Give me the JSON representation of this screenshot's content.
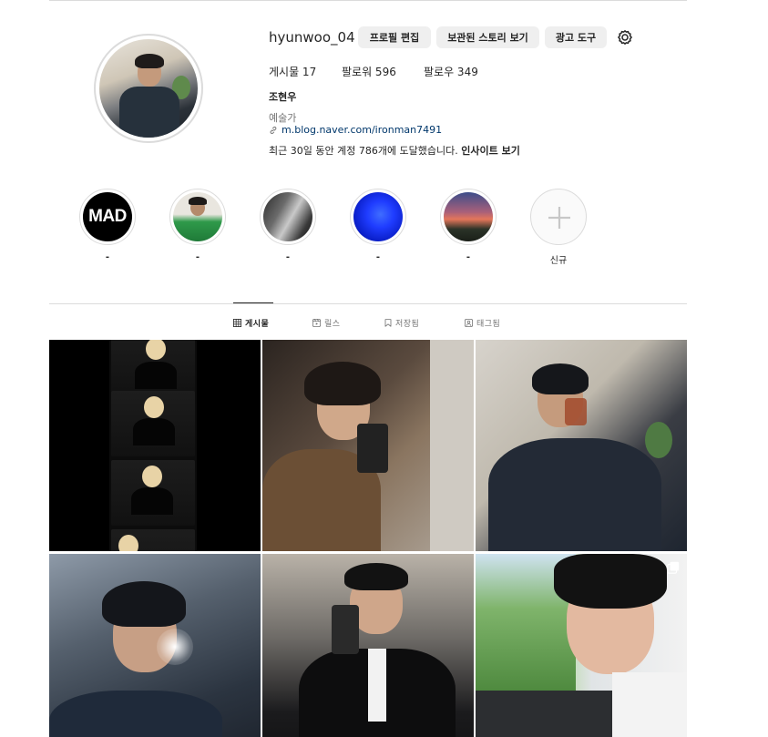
{
  "profile": {
    "username": "hyunwoo_04",
    "buttons": {
      "edit": "프로필 편집",
      "archive": "보관된 스토리 보기",
      "ads": "광고 도구"
    },
    "settings_icon": "gear-icon",
    "stats": {
      "posts": "게시물 17",
      "followers": "팔로워 596",
      "following": "팔로우 349"
    },
    "full_name": "조현우",
    "category": "예술가",
    "link": "m.blog.naver.com/ironman7491",
    "insight_text": "최근 30일 동안 계정 786개에 도달했습니다.",
    "insight_link": "인사이트 보기"
  },
  "highlights": [
    {
      "label": "-",
      "text": "MAD"
    },
    {
      "label": "-"
    },
    {
      "label": "-"
    },
    {
      "label": "-"
    },
    {
      "label": "-"
    },
    {
      "label": "신규",
      "icon": "plus-icon"
    }
  ],
  "tabs": [
    {
      "label": "게시물",
      "icon": "grid-icon",
      "active": true
    },
    {
      "label": "릴스",
      "icon": "reels-icon",
      "active": false
    },
    {
      "label": "저장됨",
      "icon": "bookmark-icon",
      "active": false
    },
    {
      "label": "태그됨",
      "icon": "tag-icon",
      "active": false
    }
  ],
  "colors": {
    "button_bg": "#efefef",
    "link": "#00376b",
    "border": "#dbdbdb",
    "muted": "#737373"
  }
}
